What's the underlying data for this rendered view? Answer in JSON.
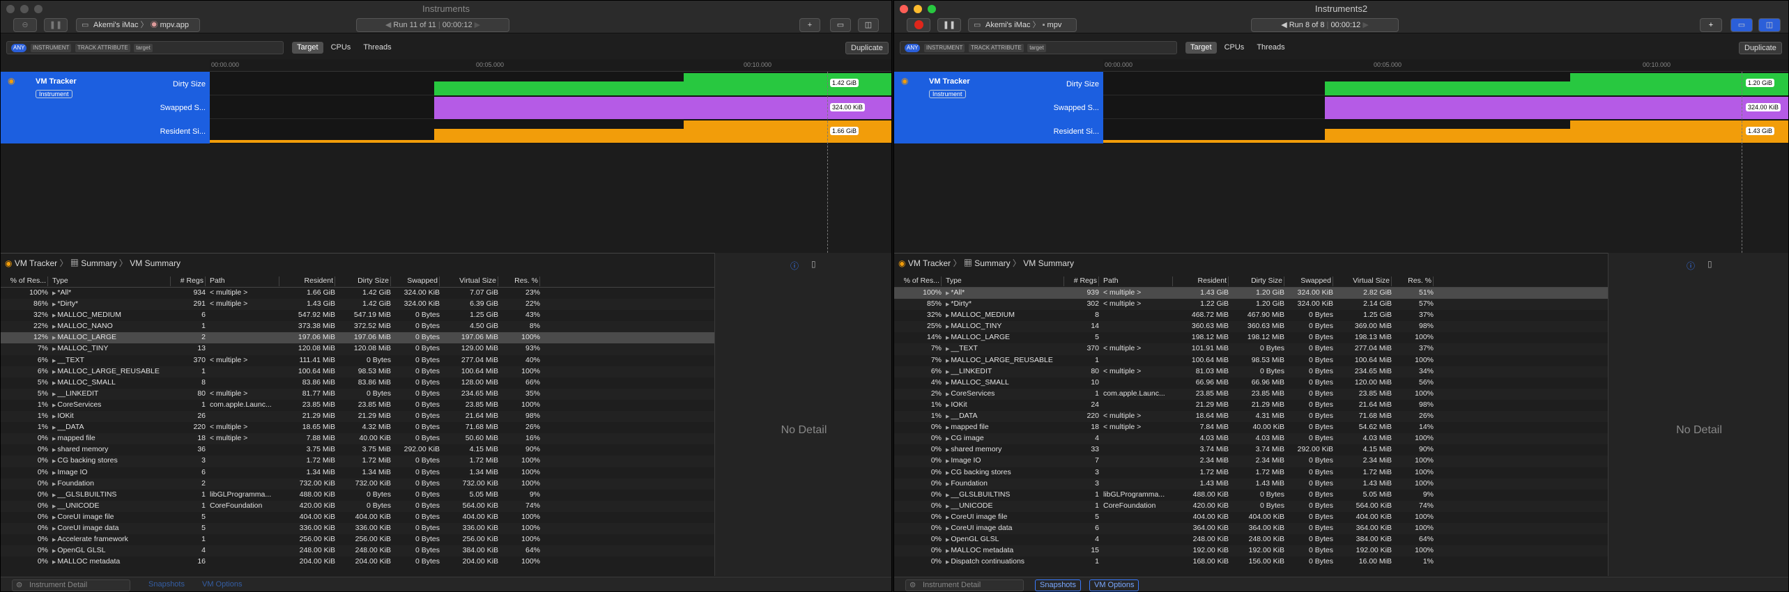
{
  "colors": {
    "track_blue": "#1c5fe0",
    "dirty": "#28c840",
    "swapped": "#b55be6",
    "resident": "#f29d0a",
    "accent": "#3a7bff"
  },
  "left": {
    "title": "Instruments",
    "target_user": "Akemi's iMac",
    "target_app": "mpv.app",
    "run": "Run 11 of 11",
    "time": "00:00:12",
    "filter": {
      "all_chip": "ANY",
      "instrument_chip": "INSTRUMENT",
      "track_chip": "TRACK ATTRIBUTE",
      "target_chip": "target"
    },
    "scopes": [
      "Target",
      "CPUs",
      "Threads"
    ],
    "duplicate": "Duplicate",
    "ruler": [
      "00:00.000",
      "00:05.000",
      "00:10.000"
    ],
    "instrument": {
      "name": "VM Tracker",
      "badge": "Instrument"
    },
    "tracks": [
      {
        "label": "Dirty Size",
        "value": "1.42 GiB"
      },
      {
        "label": "Swapped S...",
        "value": "324.00 KiB"
      },
      {
        "label": "Resident Si...",
        "value": "1.66 GiB"
      }
    ],
    "breadcrumb": {
      "instrument": "VM Tracker",
      "summary": "Summary",
      "current": "VM Summary"
    },
    "columns": [
      "% of Res...",
      "Type",
      "# Regs",
      "Path",
      "Resident",
      "Dirty Size",
      "Swapped",
      "Virtual Size",
      "Res. %"
    ],
    "rows": [
      [
        "100%",
        "*All*",
        "934",
        "< multiple >",
        "1.66 GiB",
        "1.42 GiB",
        "324.00 KiB",
        "7.07 GiB",
        "23%"
      ],
      [
        "86%",
        "*Dirty*",
        "291",
        "< multiple >",
        "1.43 GiB",
        "1.42 GiB",
        "324.00 KiB",
        "6.39 GiB",
        "22%"
      ],
      [
        "32%",
        "MALLOC_MEDIUM",
        "6",
        "",
        "547.92 MiB",
        "547.19 MiB",
        "0 Bytes",
        "1.25 GiB",
        "43%"
      ],
      [
        "22%",
        "MALLOC_NANO",
        "1",
        "",
        "373.38 MiB",
        "372.52 MiB",
        "0 Bytes",
        "4.50 GiB",
        "8%"
      ],
      [
        "12%",
        "MALLOC_LARGE",
        "2",
        "",
        "197.06 MiB",
        "197.06 MiB",
        "0 Bytes",
        "197.06 MiB",
        "100%"
      ],
      [
        "7%",
        "MALLOC_TINY",
        "13",
        "",
        "120.08 MiB",
        "120.08 MiB",
        "0 Bytes",
        "129.00 MiB",
        "93%"
      ],
      [
        "6%",
        "__TEXT",
        "370",
        "< multiple >",
        "111.41 MiB",
        "0 Bytes",
        "0 Bytes",
        "277.04 MiB",
        "40%"
      ],
      [
        "6%",
        "MALLOC_LARGE_REUSABLE",
        "1",
        "",
        "100.64 MiB",
        "98.53 MiB",
        "0 Bytes",
        "100.64 MiB",
        "100%"
      ],
      [
        "5%",
        "MALLOC_SMALL",
        "8",
        "",
        "83.86 MiB",
        "83.86 MiB",
        "0 Bytes",
        "128.00 MiB",
        "66%"
      ],
      [
        "5%",
        "__LINKEDIT",
        "80",
        "< multiple >",
        "81.77 MiB",
        "0 Bytes",
        "0 Bytes",
        "234.65 MiB",
        "35%"
      ],
      [
        "1%",
        "CoreServices",
        "1",
        "com.apple.Launc...",
        "23.85 MiB",
        "23.85 MiB",
        "0 Bytes",
        "23.85 MiB",
        "100%"
      ],
      [
        "1%",
        "IOKit",
        "26",
        "",
        "21.29 MiB",
        "21.29 MiB",
        "0 Bytes",
        "21.64 MiB",
        "98%"
      ],
      [
        "1%",
        "__DATA",
        "220",
        "< multiple >",
        "18.65 MiB",
        "4.32 MiB",
        "0 Bytes",
        "71.68 MiB",
        "26%"
      ],
      [
        "0%",
        "mapped file",
        "18",
        "< multiple >",
        "7.88 MiB",
        "40.00 KiB",
        "0 Bytes",
        "50.60 MiB",
        "16%"
      ],
      [
        "0%",
        "shared memory",
        "36",
        "",
        "3.75 MiB",
        "3.75 MiB",
        "292.00 KiB",
        "4.15 MiB",
        "90%"
      ],
      [
        "0%",
        "CG backing stores",
        "3",
        "",
        "1.72 MiB",
        "1.72 MiB",
        "0 Bytes",
        "1.72 MiB",
        "100%"
      ],
      [
        "0%",
        "Image IO",
        "6",
        "",
        "1.34 MiB",
        "1.34 MiB",
        "0 Bytes",
        "1.34 MiB",
        "100%"
      ],
      [
        "0%",
        "Foundation",
        "2",
        "",
        "732.00 KiB",
        "732.00 KiB",
        "0 Bytes",
        "732.00 KiB",
        "100%"
      ],
      [
        "0%",
        "__GLSLBUILTINS",
        "1",
        "libGLProgramma...",
        "488.00 KiB",
        "0 Bytes",
        "0 Bytes",
        "5.05 MiB",
        "9%"
      ],
      [
        "0%",
        "__UNICODE",
        "1",
        "CoreFoundation",
        "420.00 KiB",
        "0 Bytes",
        "0 Bytes",
        "564.00 KiB",
        "74%"
      ],
      [
        "0%",
        "CoreUI image file",
        "5",
        "",
        "404.00 KiB",
        "404.00 KiB",
        "0 Bytes",
        "404.00 KiB",
        "100%"
      ],
      [
        "0%",
        "CoreUI image data",
        "5",
        "",
        "336.00 KiB",
        "336.00 KiB",
        "0 Bytes",
        "336.00 KiB",
        "100%"
      ],
      [
        "0%",
        "Accelerate framework",
        "1",
        "",
        "256.00 KiB",
        "256.00 KiB",
        "0 Bytes",
        "256.00 KiB",
        "100%"
      ],
      [
        "0%",
        "OpenGL GLSL",
        "4",
        "",
        "248.00 KiB",
        "248.00 KiB",
        "0 Bytes",
        "384.00 KiB",
        "64%"
      ],
      [
        "0%",
        "MALLOC metadata",
        "16",
        "",
        "204.00 KiB",
        "204.00 KiB",
        "0 Bytes",
        "204.00 KiB",
        "100%"
      ]
    ],
    "selected_row": 4,
    "no_detail": "No Detail",
    "bottom": {
      "detail_field": "Instrument Detail",
      "snapshots": "Snapshots",
      "vm_options": "VM Options"
    }
  },
  "right": {
    "title": "Instruments2",
    "target_user": "Akemi's iMac",
    "target_app": "mpv",
    "run": "Run 8 of 8",
    "time": "00:00:12",
    "filter": {
      "all_chip": "ANY",
      "instrument_chip": "INSTRUMENT",
      "track_chip": "TRACK ATTRIBUTE",
      "target_chip": "target"
    },
    "scopes": [
      "Target",
      "CPUs",
      "Threads"
    ],
    "duplicate": "Duplicate",
    "ruler": [
      "00:00.000",
      "00:05.000",
      "00:10.000"
    ],
    "instrument": {
      "name": "VM Tracker",
      "badge": "Instrument"
    },
    "tracks": [
      {
        "label": "Dirty Size",
        "value": "1.20 GiB"
      },
      {
        "label": "Swapped S...",
        "value": "324.00 KiB"
      },
      {
        "label": "Resident Si...",
        "value": "1.43 GiB"
      }
    ],
    "breadcrumb": {
      "instrument": "VM Tracker",
      "summary": "Summary",
      "current": "VM Summary"
    },
    "columns": [
      "% of Res...",
      "Type",
      "# Regs",
      "Path",
      "Resident",
      "Dirty Size",
      "Swapped",
      "Virtual Size",
      "Res. %"
    ],
    "rows": [
      [
        "100%",
        "*All*",
        "939",
        "< multiple >",
        "1.43 GiB",
        "1.20 GiB",
        "324.00 KiB",
        "2.82 GiB",
        "51%"
      ],
      [
        "85%",
        "*Dirty*",
        "302",
        "< multiple >",
        "1.22 GiB",
        "1.20 GiB",
        "324.00 KiB",
        "2.14 GiB",
        "57%"
      ],
      [
        "32%",
        "MALLOC_MEDIUM",
        "8",
        "",
        "468.72 MiB",
        "467.90 MiB",
        "0 Bytes",
        "1.25 GiB",
        "37%"
      ],
      [
        "25%",
        "MALLOC_TINY",
        "14",
        "",
        "360.63 MiB",
        "360.63 MiB",
        "0 Bytes",
        "369.00 MiB",
        "98%"
      ],
      [
        "14%",
        "MALLOC_LARGE",
        "5",
        "",
        "198.12 MiB",
        "198.12 MiB",
        "0 Bytes",
        "198.13 MiB",
        "100%"
      ],
      [
        "7%",
        "__TEXT",
        "370",
        "< multiple >",
        "101.91 MiB",
        "0 Bytes",
        "0 Bytes",
        "277.04 MiB",
        "37%"
      ],
      [
        "7%",
        "MALLOC_LARGE_REUSABLE",
        "1",
        "",
        "100.64 MiB",
        "98.53 MiB",
        "0 Bytes",
        "100.64 MiB",
        "100%"
      ],
      [
        "6%",
        "__LINKEDIT",
        "80",
        "< multiple >",
        "81.03 MiB",
        "0 Bytes",
        "0 Bytes",
        "234.65 MiB",
        "34%"
      ],
      [
        "4%",
        "MALLOC_SMALL",
        "10",
        "",
        "66.96 MiB",
        "66.96 MiB",
        "0 Bytes",
        "120.00 MiB",
        "56%"
      ],
      [
        "2%",
        "CoreServices",
        "1",
        "com.apple.Launc...",
        "23.85 MiB",
        "23.85 MiB",
        "0 Bytes",
        "23.85 MiB",
        "100%"
      ],
      [
        "1%",
        "IOKit",
        "24",
        "",
        "21.29 MiB",
        "21.29 MiB",
        "0 Bytes",
        "21.64 MiB",
        "98%"
      ],
      [
        "1%",
        "__DATA",
        "220",
        "< multiple >",
        "18.64 MiB",
        "4.31 MiB",
        "0 Bytes",
        "71.68 MiB",
        "26%"
      ],
      [
        "0%",
        "mapped file",
        "18",
        "< multiple >",
        "7.84 MiB",
        "40.00 KiB",
        "0 Bytes",
        "54.62 MiB",
        "14%"
      ],
      [
        "0%",
        "CG image",
        "4",
        "",
        "4.03 MiB",
        "4.03 MiB",
        "0 Bytes",
        "4.03 MiB",
        "100%"
      ],
      [
        "0%",
        "shared memory",
        "33",
        "",
        "3.74 MiB",
        "3.74 MiB",
        "292.00 KiB",
        "4.15 MiB",
        "90%"
      ],
      [
        "0%",
        "Image IO",
        "7",
        "",
        "2.34 MiB",
        "2.34 MiB",
        "0 Bytes",
        "2.34 MiB",
        "100%"
      ],
      [
        "0%",
        "CG backing stores",
        "3",
        "",
        "1.72 MiB",
        "1.72 MiB",
        "0 Bytes",
        "1.72 MiB",
        "100%"
      ],
      [
        "0%",
        "Foundation",
        "3",
        "",
        "1.43 MiB",
        "1.43 MiB",
        "0 Bytes",
        "1.43 MiB",
        "100%"
      ],
      [
        "0%",
        "__GLSLBUILTINS",
        "1",
        "libGLProgramma...",
        "488.00 KiB",
        "0 Bytes",
        "0 Bytes",
        "5.05 MiB",
        "9%"
      ],
      [
        "0%",
        "__UNICODE",
        "1",
        "CoreFoundation",
        "420.00 KiB",
        "0 Bytes",
        "0 Bytes",
        "564.00 KiB",
        "74%"
      ],
      [
        "0%",
        "CoreUI image file",
        "5",
        "",
        "404.00 KiB",
        "404.00 KiB",
        "0 Bytes",
        "404.00 KiB",
        "100%"
      ],
      [
        "0%",
        "CoreUI image data",
        "6",
        "",
        "364.00 KiB",
        "364.00 KiB",
        "0 Bytes",
        "364.00 KiB",
        "100%"
      ],
      [
        "0%",
        "OpenGL GLSL",
        "4",
        "",
        "248.00 KiB",
        "248.00 KiB",
        "0 Bytes",
        "384.00 KiB",
        "64%"
      ],
      [
        "0%",
        "MALLOC metadata",
        "15",
        "",
        "192.00 KiB",
        "192.00 KiB",
        "0 Bytes",
        "192.00 KiB",
        "100%"
      ],
      [
        "0%",
        "Dispatch continuations",
        "1",
        "",
        "168.00 KiB",
        "156.00 KiB",
        "0 Bytes",
        "16.00 MiB",
        "1%"
      ]
    ],
    "selected_row": 0,
    "no_detail": "No Detail",
    "bottom": {
      "detail_field": "Instrument Detail",
      "snapshots": "Snapshots",
      "vm_options": "VM Options"
    }
  }
}
